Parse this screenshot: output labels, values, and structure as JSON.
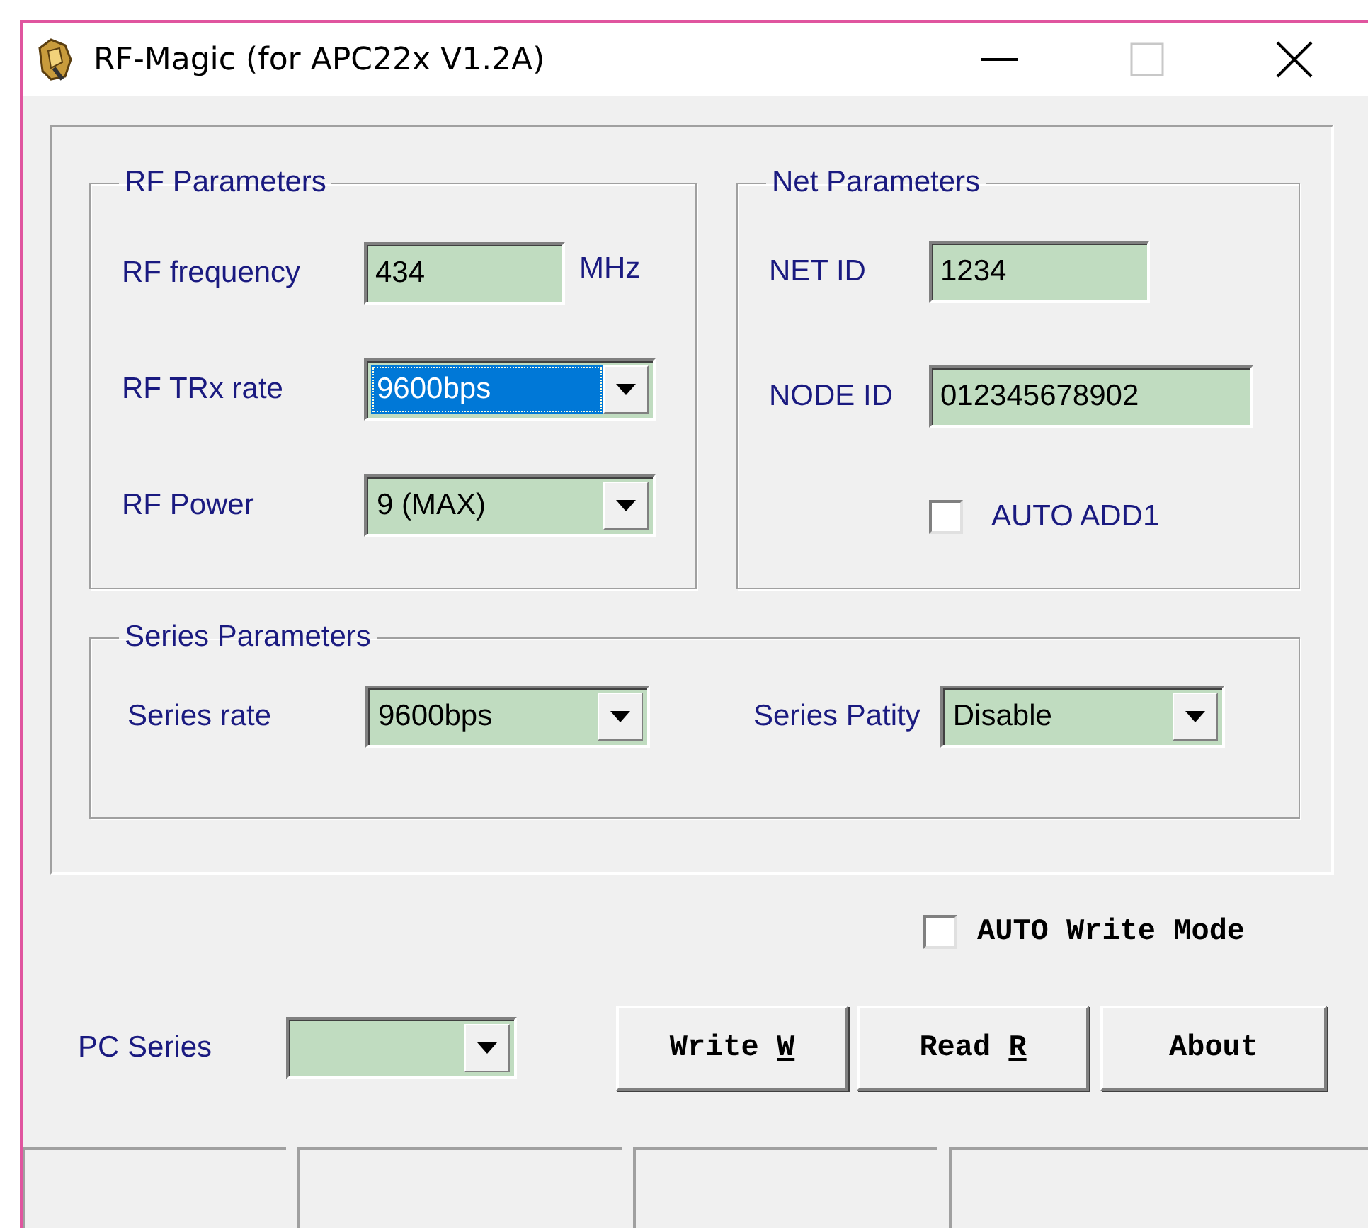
{
  "window": {
    "title": "RF-Magic (for APC22x V1.2A)"
  },
  "rf_parameters": {
    "title": "RF Parameters",
    "frequency": {
      "label": "RF frequency",
      "value": "434",
      "unit": "MHz"
    },
    "trx_rate": {
      "label": "RF TRx rate",
      "value": "9600bps",
      "focused": true
    },
    "power": {
      "label": "RF Power",
      "value": "9 (MAX)",
      "focused": false
    }
  },
  "net_parameters": {
    "title": "Net Parameters",
    "net_id": {
      "label": "NET ID",
      "value": "1234"
    },
    "node_id": {
      "label": "NODE ID",
      "value": "012345678902"
    },
    "auto_add": {
      "label": "AUTO ADD1",
      "checked": false
    }
  },
  "series_parameters": {
    "title": "Series Parameters",
    "rate": {
      "label": "Series rate",
      "value": "9600bps",
      "focused": false
    },
    "parity": {
      "label": "Series Patity",
      "value": "Disable",
      "focused": false
    }
  },
  "auto_write_mode": {
    "label": "AUTO Write Mode",
    "checked": false
  },
  "pc_series": {
    "label": "PC  Series"
  },
  "buttons": [
    {
      "label": "Write ",
      "accesskey": "W"
    },
    {
      "label": "Read ",
      "accesskey": "R"
    },
    {
      "label": "About"
    }
  ]
}
